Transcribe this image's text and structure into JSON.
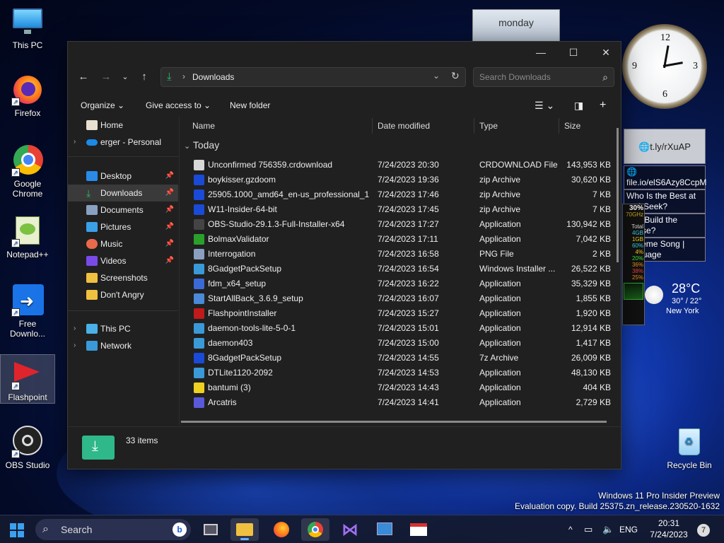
{
  "desktop": {
    "icons": [
      {
        "label": "This PC"
      },
      {
        "label": "Firefox"
      },
      {
        "label": "Google Chrome"
      },
      {
        "label": "Notepad++"
      },
      {
        "label": "Free Downlo..."
      },
      {
        "label": "Flashpoint"
      },
      {
        "label": "OBS Studio"
      },
      {
        "label": "Recycle Bin"
      }
    ],
    "watermark_line1": "Windows 11 Pro Insider Preview",
    "watermark_line2": "Evaluation copy. Build 25375.zn_release.230520-1632"
  },
  "gadgets": {
    "calendar_day": "monday",
    "links": [
      "t.ly/rXuAP",
      "file.io/elS6Azy8CcpM",
      "Who Is the Best at and-Seek?",
      "Can Build the House?",
      "r Theme Song | language"
    ],
    "meter": {
      "cpu": "30%",
      "freq": "70GHz",
      "total": "Total",
      "mem": "4GB",
      "used": "1GB",
      "p1": "60%",
      "p2": "4%",
      "p3": "20%",
      "p4": "36%",
      "p5": "38%",
      "p6": "25%"
    },
    "weather": {
      "temp": "28°C",
      "range": "30° / 22°",
      "city": "New York"
    }
  },
  "explorer": {
    "address": {
      "location": "Downloads"
    },
    "search_placeholder": "Search Downloads",
    "commands": {
      "organize": "Organize",
      "share": "Give access to",
      "new_folder": "New folder"
    },
    "nav": [
      {
        "label": "Home"
      },
      {
        "label": "erger - Personal"
      },
      {
        "label": "Desktop"
      },
      {
        "label": "Downloads"
      },
      {
        "label": "Documents"
      },
      {
        "label": "Pictures"
      },
      {
        "label": "Music"
      },
      {
        "label": "Videos"
      },
      {
        "label": "Screenshots"
      },
      {
        "label": "Don't Angry"
      },
      {
        "label": "This PC"
      },
      {
        "label": "Network"
      }
    ],
    "columns": {
      "name": "Name",
      "date": "Date modified",
      "type": "Type",
      "size": "Size"
    },
    "group": "Today",
    "files": [
      {
        "name": "Unconfirmed 756359.crdownload",
        "date": "7/24/2023 20:30",
        "type": "CRDOWNLOAD File",
        "size": "143,953 KB"
      },
      {
        "name": "boykisser.gzdoom",
        "date": "7/24/2023 19:36",
        "type": "zip Archive",
        "size": "30,620 KB"
      },
      {
        "name": "25905.1000_amd64_en-us_professional_1...",
        "date": "7/24/2023 17:46",
        "type": "zip Archive",
        "size": "7 KB"
      },
      {
        "name": "W11-Insider-64-bit",
        "date": "7/24/2023 17:45",
        "type": "zip Archive",
        "size": "7 KB"
      },
      {
        "name": "OBS-Studio-29.1.3-Full-Installer-x64",
        "date": "7/24/2023 17:27",
        "type": "Application",
        "size": "130,942 KB"
      },
      {
        "name": "BolmaxValidator",
        "date": "7/24/2023 17:11",
        "type": "Application",
        "size": "7,042 KB"
      },
      {
        "name": "Interrogation",
        "date": "7/24/2023 16:58",
        "type": "PNG File",
        "size": "2 KB"
      },
      {
        "name": "8GadgetPackSetup",
        "date": "7/24/2023 16:54",
        "type": "Windows Installer ...",
        "size": "26,522 KB"
      },
      {
        "name": "fdm_x64_setup",
        "date": "7/24/2023 16:22",
        "type": "Application",
        "size": "35,329 KB"
      },
      {
        "name": "StartAllBack_3.6.9_setup",
        "date": "7/24/2023 16:07",
        "type": "Application",
        "size": "1,855 KB"
      },
      {
        "name": "FlashpointInstaller",
        "date": "7/24/2023 15:27",
        "type": "Application",
        "size": "1,920 KB"
      },
      {
        "name": "daemon-tools-lite-5-0-1",
        "date": "7/24/2023 15:01",
        "type": "Application",
        "size": "12,914 KB"
      },
      {
        "name": "daemon403",
        "date": "7/24/2023 15:00",
        "type": "Application",
        "size": "1,417 KB"
      },
      {
        "name": "8GadgetPackSetup",
        "date": "7/24/2023 14:55",
        "type": "7z Archive",
        "size": "26,009 KB"
      },
      {
        "name": "DTLite1120-2092",
        "date": "7/24/2023 14:53",
        "type": "Application",
        "size": "48,130 KB"
      },
      {
        "name": "bantumi (3)",
        "date": "7/24/2023 14:43",
        "type": "Application",
        "size": "404 KB"
      },
      {
        "name": "Arcatris",
        "date": "7/24/2023 14:41",
        "type": "Application",
        "size": "2,729 KB"
      }
    ],
    "status": {
      "count": "33 items"
    }
  },
  "taskbar": {
    "search_label": "Search",
    "language": "ENG",
    "time": "20:31",
    "date": "7/24/2023",
    "notification_count": "7"
  }
}
